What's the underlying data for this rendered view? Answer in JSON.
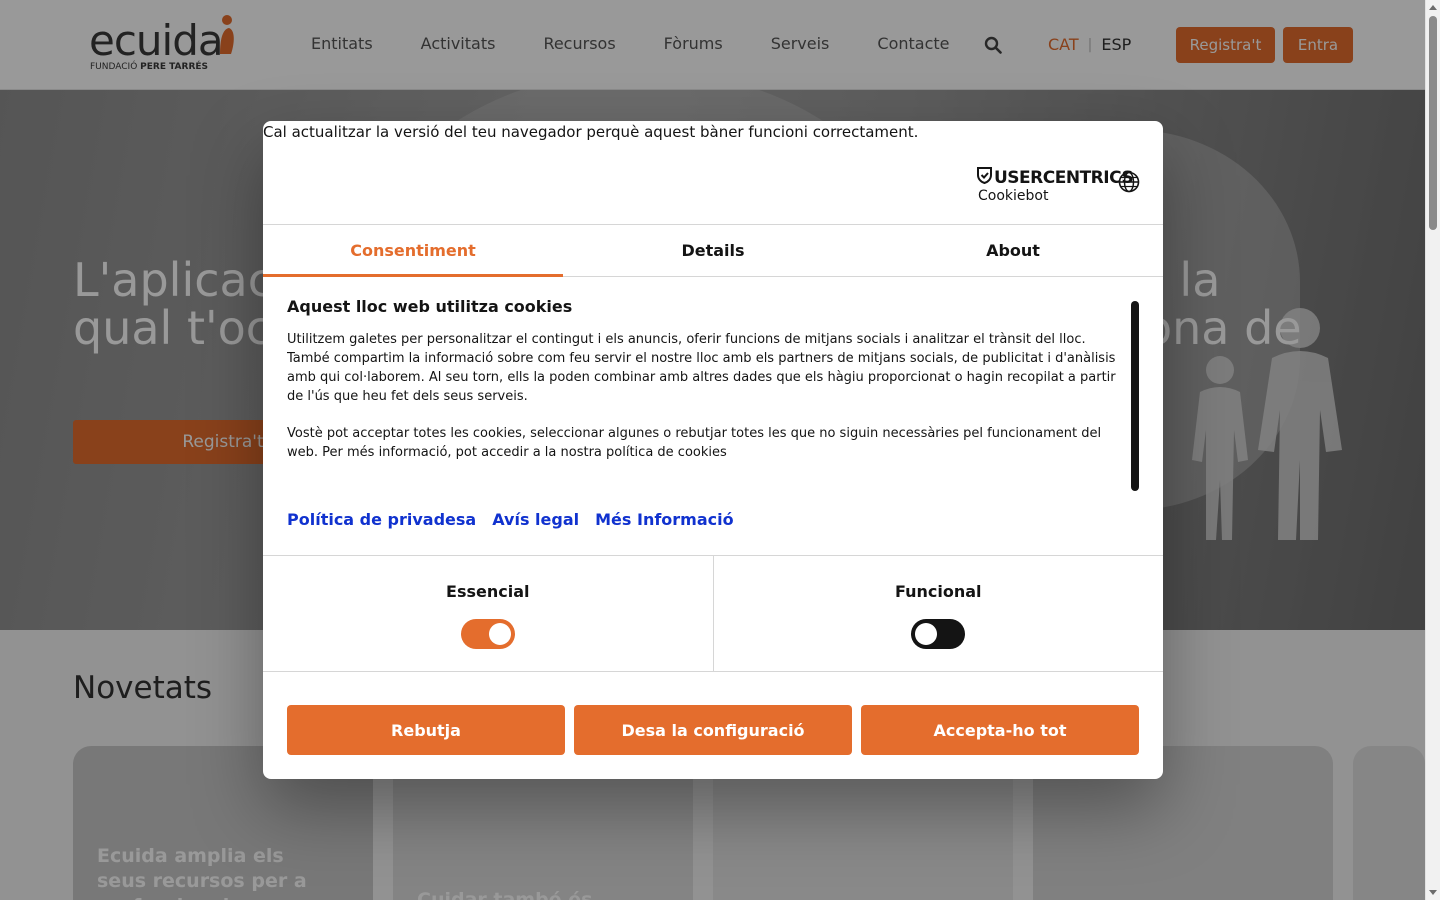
{
  "header": {
    "logo_word": "ecuida",
    "logo_sub_prefix": "FUNDACIÓ ",
    "logo_sub_bold": "PERE TARRÉS",
    "nav": [
      "Entitats",
      "Activitats",
      "Recursos",
      "Fòrums",
      "Serveis",
      "Contacte"
    ],
    "search_icon": "search-icon",
    "lang_cat": "CAT",
    "lang_sep": "|",
    "lang_esp": "ESP",
    "register_label": "Registra't",
    "login_label": "Entra",
    "accent_color": "#e46d2d"
  },
  "hero": {
    "title": "L'aplicació per millorar la vida de la persona de la qual t'ocupes",
    "title_visible_right": "sona de",
    "button_label": "Registra't"
  },
  "news": {
    "title": "Novetats",
    "cards": [
      {
        "title": "Ecuida amplia els seus recursos per a professionals"
      },
      {
        "title": "Cuidar també és..."
      },
      {
        "title": ""
      },
      {
        "title": ""
      },
      {
        "title": ""
      }
    ]
  },
  "cookie_dialog": {
    "browser_warning": "Cal actualitzar la versió del teu navegador perquè aquest bàner funcioni correctament.",
    "brand_main": "USERCENTRICS",
    "brand_sub": "Cookiebot",
    "globe_icon": "globe-icon",
    "tabs": [
      "Consentiment",
      "Details",
      "About"
    ],
    "active_tab": "Consentiment",
    "heading": "Aquest lloc web utilitza cookies",
    "paragraph_1": "Utilitzem galetes per personalitzar el contingut i els anuncis, oferir funcions de mitjans socials i analitzar el trànsit del lloc. També compartim la informació sobre com feu servir el nostre lloc amb els partners de mitjans socials, de publicitat i d'anàlisis amb qui col·laborem. Al seu torn, ells la poden combinar amb altres dades que els hàgiu proporcionat o hagin recopilat a partir de l'ús que heu fet dels seus serveis.",
    "paragraph_2": "Vostè pot acceptar totes les cookies, seleccionar algunes o rebutjar totes les que no siguin necessàries pel funcionament del web. Per més informació, pot accedir a la nostra",
    "cookie_policy_link": "política de cookies",
    "links": [
      "Política de privadesa",
      "Avís legal",
      "Més Informació"
    ],
    "toggles": [
      {
        "label": "Essencial",
        "state": "on"
      },
      {
        "label": "Funcional",
        "state": "off"
      }
    ],
    "buttons": {
      "reject": "Rebutja",
      "save": "Desa la configuració",
      "accept_all": "Accepta-ho tot"
    },
    "link_color": "#1032cf"
  }
}
